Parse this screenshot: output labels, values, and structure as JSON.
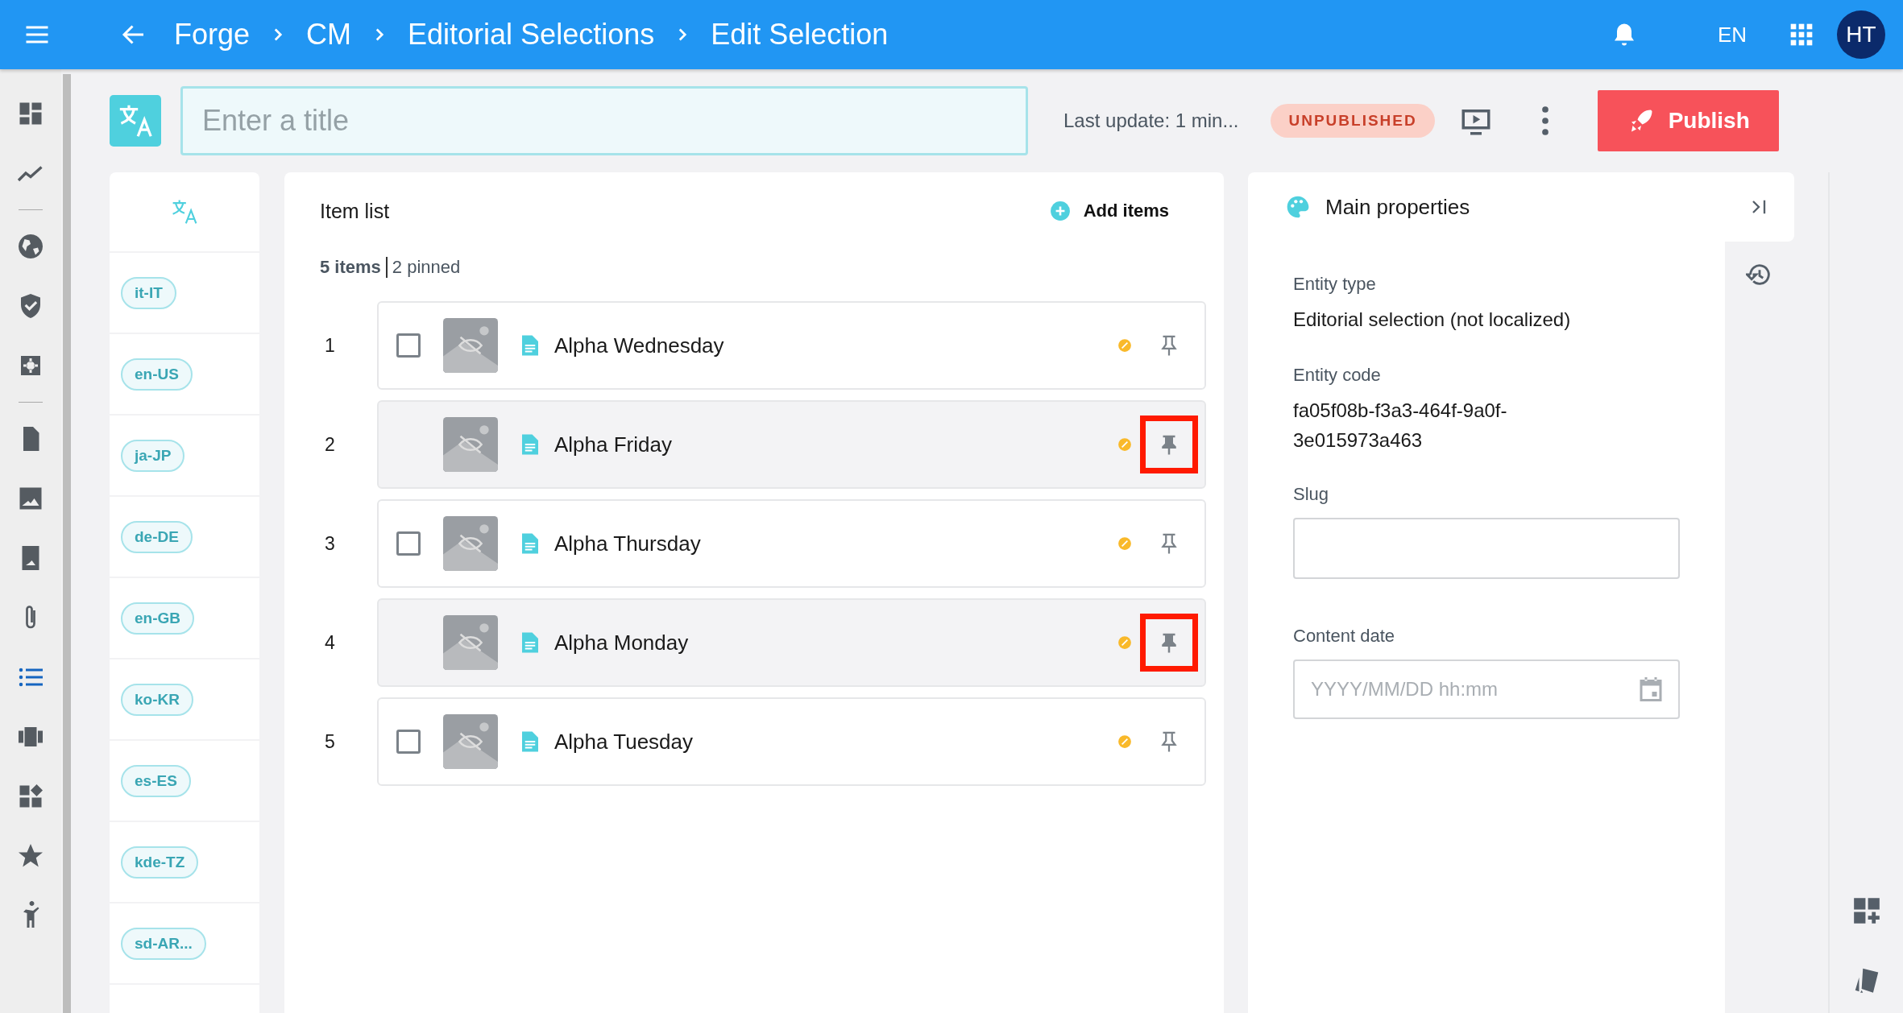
{
  "top_bar": {
    "breadcrumbs": [
      "Forge",
      "CM",
      "Editorial Selections",
      "Edit Selection"
    ],
    "language": "EN",
    "avatar": "HT"
  },
  "sidebar": {
    "items": [
      {
        "kind": "icon",
        "selected": false
      },
      {
        "kind": "icon",
        "selected": false
      },
      {
        "kind": "divider"
      },
      {
        "kind": "icon",
        "selected": false
      },
      {
        "kind": "icon",
        "selected": false
      },
      {
        "kind": "icon",
        "selected": false
      },
      {
        "kind": "divider"
      },
      {
        "kind": "icon",
        "selected": false
      },
      {
        "kind": "icon",
        "selected": false
      },
      {
        "kind": "icon",
        "selected": false
      },
      {
        "kind": "icon",
        "selected": false
      },
      {
        "kind": "icon",
        "selected": true
      },
      {
        "kind": "icon",
        "selected": false
      },
      {
        "kind": "icon",
        "selected": false
      },
      {
        "kind": "icon",
        "selected": false
      },
      {
        "kind": "icon",
        "selected": false
      }
    ]
  },
  "header": {
    "title_placeholder": "Enter a title",
    "last_update": "Last update: 1 min...",
    "status": "UNPUBLISHED",
    "publish_button": "Publish"
  },
  "locales": [
    "it-IT",
    "en-US",
    "ja-JP",
    "de-DE",
    "en-GB",
    "ko-KR",
    "es-ES",
    "kde-TZ",
    "sd-AR..."
  ],
  "item_list": {
    "title": "Item list",
    "add_button": "Add items",
    "count": "5 items",
    "pinned_count": "2 pinned",
    "items": [
      {
        "number": "1",
        "name": "Alpha Wednesday",
        "pinned": false,
        "highlighted": false
      },
      {
        "number": "2",
        "name": "Alpha Friday",
        "pinned": true,
        "highlighted": true
      },
      {
        "number": "3",
        "name": "Alpha Thursday",
        "pinned": false,
        "highlighted": false
      },
      {
        "number": "4",
        "name": "Alpha Monday",
        "pinned": true,
        "highlighted": true
      },
      {
        "number": "5",
        "name": "Alpha Tuesday",
        "pinned": false,
        "highlighted": false
      }
    ]
  },
  "properties": {
    "title": "Main properties",
    "entity_type_label": "Entity type",
    "entity_type": "Editorial selection (not localized)",
    "entity_code_label": "Entity code",
    "entity_code": "fa05f08b-f3a3-464f-9a0f-3e015973a463",
    "slug_label": "Slug",
    "content_date_label": "Content date",
    "content_date_placeholder": "YYYY/MM/DD hh:mm"
  }
}
